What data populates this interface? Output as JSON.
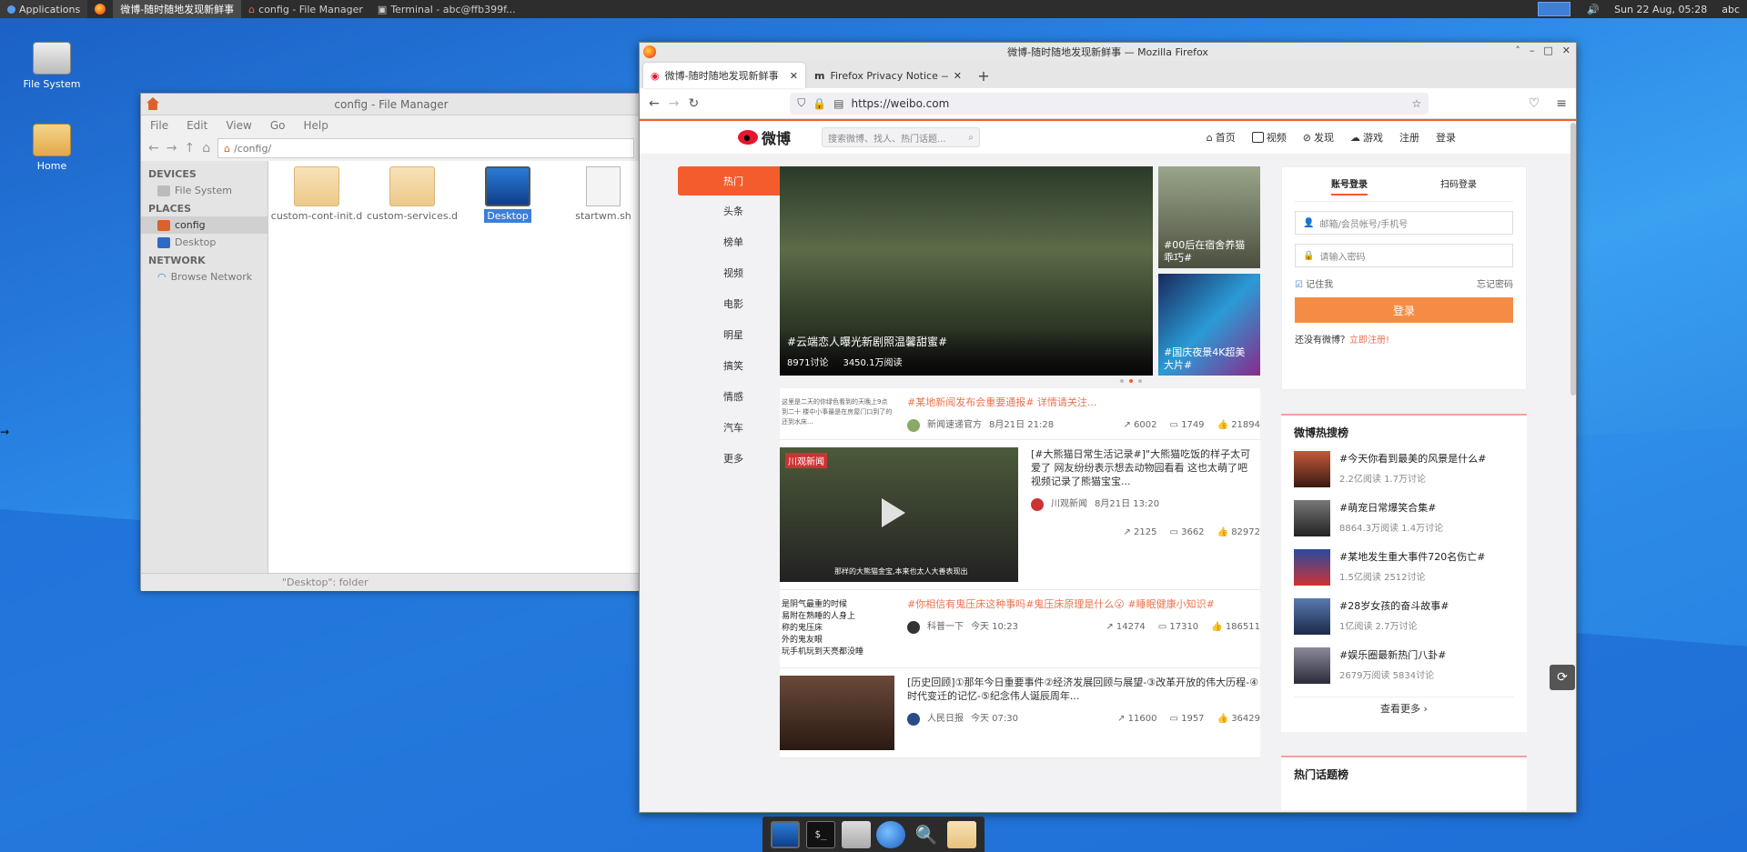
{
  "top_panel": {
    "apps_label": "Applications",
    "tasks": [
      {
        "label": "微博-随时随地发现新鲜事",
        "active": true
      },
      {
        "label": "config - File Manager",
        "active": false
      },
      {
        "label": "Terminal - abc@ffb399f...",
        "active": false
      }
    ],
    "clock": "Sun 22 Aug, 05:28",
    "user": "abc"
  },
  "desktop": {
    "icons": [
      {
        "label": "File System",
        "icon": "drive-icon"
      },
      {
        "label": "Home",
        "icon": "home-folder-icon"
      }
    ]
  },
  "file_manager": {
    "title": "config - File Manager",
    "menu": [
      "File",
      "Edit",
      "View",
      "Go",
      "Help"
    ],
    "path": "/config/",
    "sidebar": {
      "devices_header": "DEVICES",
      "devices": [
        "File System"
      ],
      "places_header": "PLACES",
      "places": [
        "config",
        "Desktop"
      ],
      "network_header": "NETWORK",
      "network": [
        "Browse Network"
      ]
    },
    "files": [
      {
        "name": "custom-cont-init.d",
        "type": "folder"
      },
      {
        "name": "custom-services.d",
        "type": "folder"
      },
      {
        "name": "Desktop",
        "type": "desktop",
        "selected": true
      },
      {
        "name": "startwm.sh",
        "type": "script"
      }
    ],
    "status": "\"Desktop\": folder"
  },
  "firefox": {
    "window_title": "微博-随时随地发现新鲜事 — Mozilla Firefox",
    "tabs": [
      {
        "label": "微博-随时随地发现新鲜事",
        "active": true
      },
      {
        "label": "Firefox Privacy Notice —",
        "active": false
      }
    ],
    "url": "https://weibo.com"
  },
  "weibo": {
    "logo_text": "微博",
    "search_placeholder": "搜索微博、找人、热门话题...",
    "nav": [
      "首页",
      "视频",
      "发现",
      "游戏",
      "注册",
      "登录"
    ],
    "left_nav": [
      "热门",
      "头条",
      "榜单",
      "视频",
      "电影",
      "明星",
      "搞笑",
      "情感",
      "汽车",
      "更多"
    ],
    "hero": {
      "caption": "#云端恋人曝光新剧照温馨甜蜜#",
      "stat1": "8971讨论",
      "stat2": "3450.1万阅读",
      "side1": "#00后在宿舍养猫 乖巧#",
      "side2": "#国庆夜景4K超美大片#"
    },
    "feed": [
      {
        "text": "#某地新闻发布会重要通报# 详情请关注...",
        "author": "新闻速递官方",
        "time": "8月21日 21:28",
        "shares": "6002",
        "comments": "1749",
        "likes": "21894",
        "thumb_text": "这里是二天的你绿色看到的天晚上9点到二十 楼中小事最是在房屋门口到了的还到水床..."
      },
      {
        "text": "[#大熊猫日常生活记录#]\"大熊猫吃饭的样子太可爱了 网友纷纷表示想去动物园看看 这也太萌了吧 视频记录了熊猫宝宝...",
        "author": "川观新闻",
        "time": "8月21日 13:20",
        "shares": "2125",
        "comments": "3662",
        "likes": "82972",
        "video_label": "川观新闻",
        "video_caption": "那样的大熊猫金宝,本来也太人大善表现出"
      },
      {
        "text": "#你相信有鬼压床这种事吗#鬼压床原理是什么😮 #睡眠健康小知识#",
        "author": "科普一下",
        "time": "今天 10:23",
        "shares": "14274",
        "comments": "17310",
        "likes": "186511",
        "thumb_lines": [
          "是阴气最重的时候",
          "易附在熟睡的人身上",
          "称的鬼压床",
          "外的鬼友眼",
          "玩手机玩到天亮都没睡"
        ]
      },
      {
        "text": "[历史回顾]①那年今日重要事件②经济发展回顾与展望-③改革开放的伟大历程-④时代变迁的记忆-⑤纪念伟人诞辰周年...",
        "author": "人民日报",
        "time": "今天 07:30",
        "shares": "11600",
        "comments": "1957",
        "likes": "36429"
      }
    ],
    "login": {
      "tab_account": "账号登录",
      "tab_qr": "扫码登录",
      "user_placeholder": "邮箱/会员帐号/手机号",
      "pass_placeholder": "请输入密码",
      "remember": "记住我",
      "forgot": "忘记密码",
      "button": "登录",
      "register_prefix": "还没有微博？",
      "register_link": "立即注册!"
    },
    "hot_title": "微博热搜榜",
    "hot": [
      {
        "title": "#今天你看到最美的风景是什么#",
        "stats": "2.2亿阅读 1.7万讨论"
      },
      {
        "title": "#萌宠日常爆笑合集#",
        "stats": "8864.3万阅读 1.4万讨论"
      },
      {
        "title": "#某地发生重大事件720名伤亡#",
        "stats": "1.5亿阅读 2512讨论"
      },
      {
        "title": "#28岁女孩的奋斗故事#",
        "stats": "1亿阅读 2.7万讨论"
      },
      {
        "title": "#娱乐圈最新热门八卦#",
        "stats": "2679万阅读 5834讨论"
      }
    ],
    "more": "查看更多 ›",
    "hot2_title": "热门话题榜"
  }
}
